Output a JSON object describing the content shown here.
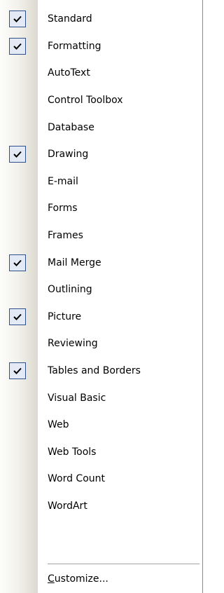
{
  "menu": {
    "items": [
      {
        "label": "Standard",
        "checked": true
      },
      {
        "label": "Formatting",
        "checked": true
      },
      {
        "label": "AutoText",
        "checked": false
      },
      {
        "label": "Control Toolbox",
        "checked": false
      },
      {
        "label": "Database",
        "checked": false
      },
      {
        "label": "Drawing",
        "checked": true
      },
      {
        "label": "E-mail",
        "checked": false
      },
      {
        "label": "Forms",
        "checked": false
      },
      {
        "label": "Frames",
        "checked": false
      },
      {
        "label": "Mail Merge",
        "checked": true
      },
      {
        "label": "Outlining",
        "checked": false
      },
      {
        "label": "Picture",
        "checked": true
      },
      {
        "label": "Reviewing",
        "checked": false
      },
      {
        "label": "Tables and Borders",
        "checked": true
      },
      {
        "label": "Visual Basic",
        "checked": false
      },
      {
        "label": "Web",
        "checked": false
      },
      {
        "label": "Web Tools",
        "checked": false
      },
      {
        "label": "Word Count",
        "checked": false
      },
      {
        "label": "WordArt",
        "checked": false
      }
    ],
    "customize": {
      "accel": "C",
      "rest": "ustomize..."
    }
  },
  "colors": {
    "check_border": "#2e4f8a",
    "check_fill": "#e3e9f5"
  }
}
